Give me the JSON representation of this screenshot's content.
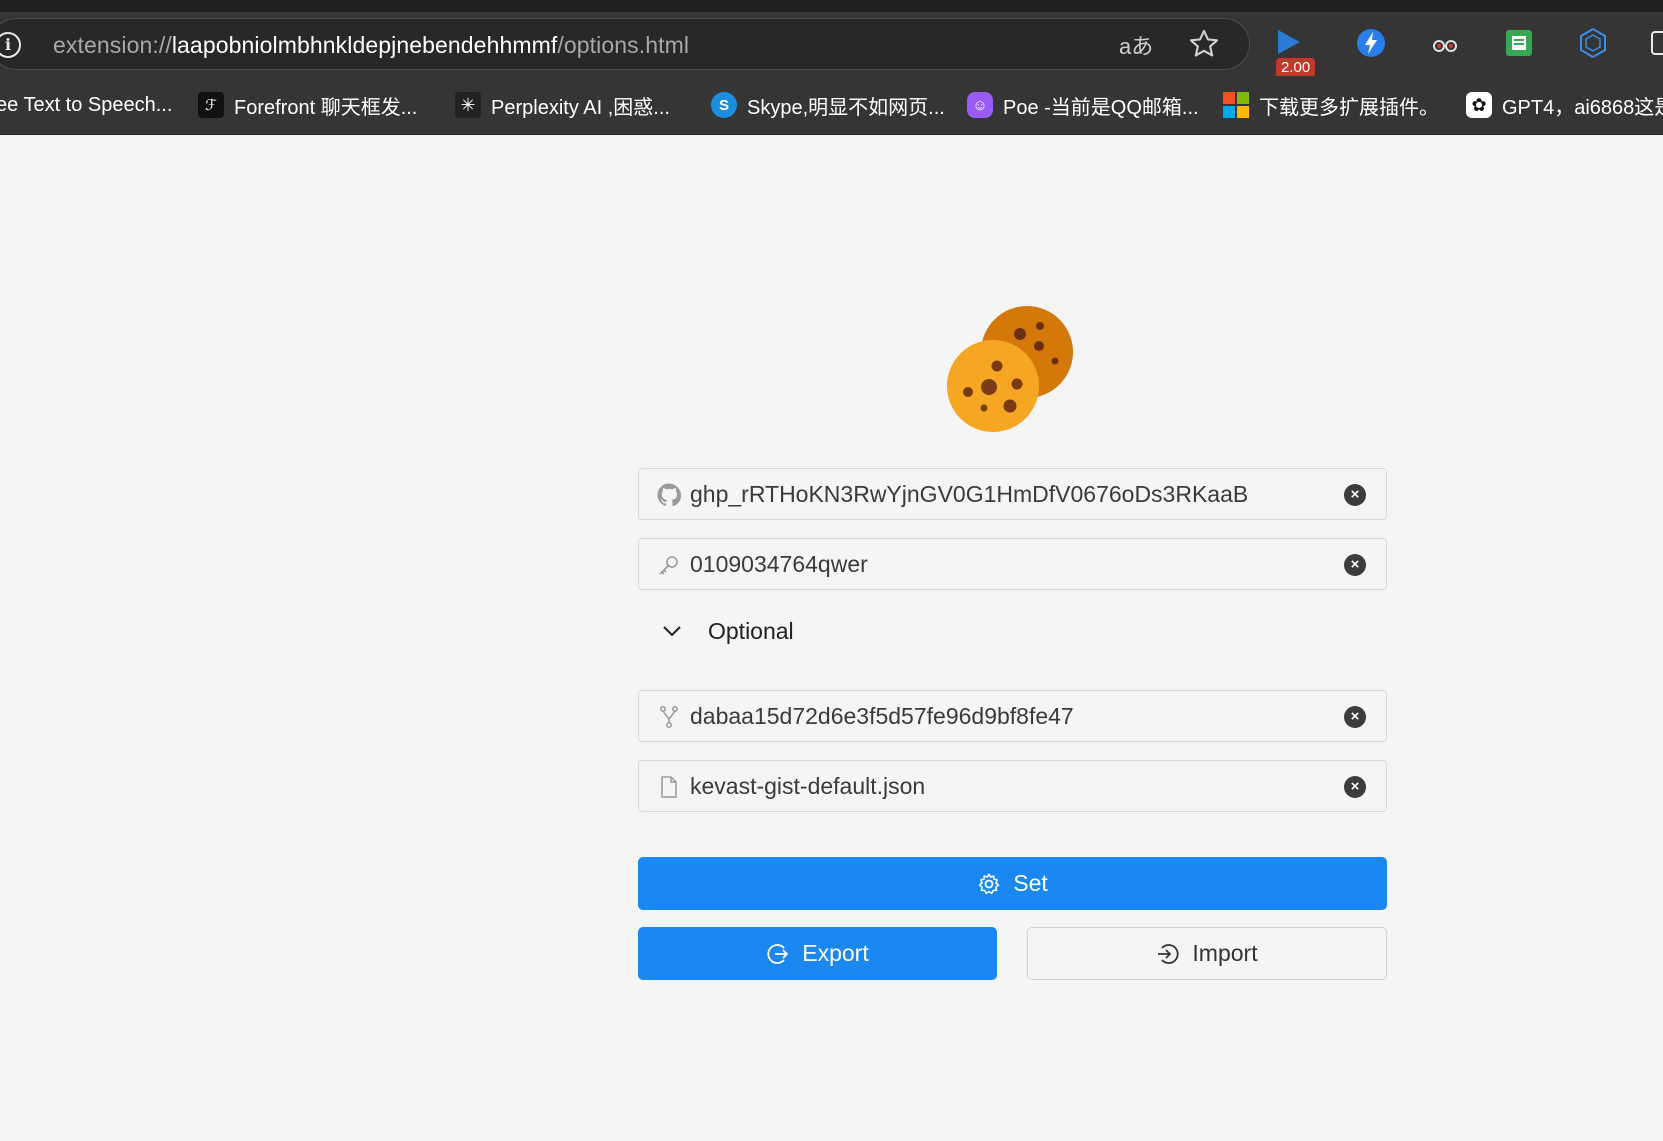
{
  "browser": {
    "url_scheme": "extension://",
    "url_host": "laapobniolmbhnkldepjnebendehhmmf",
    "url_path": "/options.html",
    "read_aloud_glyph": "aあ",
    "speed_badge": "2.00",
    "bookmarks": [
      {
        "label": "ee Text to Speech...",
        "icon": "speech-icon",
        "color": "#353535"
      },
      {
        "label": "Forefront 聊天框发...",
        "icon": "forefront-icon",
        "color": "#111111"
      },
      {
        "label": "Perplexity AI ,困惑...",
        "icon": "perplexity-icon",
        "color": "#222222"
      },
      {
        "label": "Skype,明显不如网页...",
        "icon": "skype-icon",
        "color": "#1a8ee1"
      },
      {
        "label": "Poe -当前是QQ邮箱...",
        "icon": "poe-icon",
        "color": "#9b5cf6"
      },
      {
        "label": "下载更多扩展插件。",
        "icon": "microsoft-icon",
        "color": "#f25022"
      },
      {
        "label": "GPT4，ai6868这是",
        "icon": "openai-icon",
        "color": "#ffffff"
      }
    ]
  },
  "form": {
    "token_value": "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",
    "password_value": "0109034764qwer",
    "optional_label": "Optional",
    "gist_id_value": "dabaa15d72d6e3f5d57fe96d9bf8fe47",
    "filename_value": "kevast-gist-default.json",
    "set_label": "Set",
    "export_label": "Export",
    "import_label": "Import",
    "clear_glyph": "×"
  },
  "colors": {
    "primary": "#1a88f0",
    "cookie_front": "#f5a623",
    "cookie_back": "#d4780a",
    "chip": "#7a3a12"
  }
}
